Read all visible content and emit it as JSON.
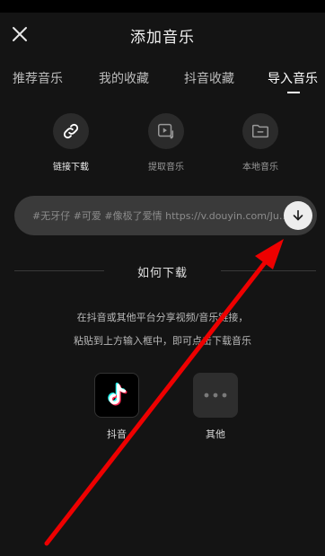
{
  "header": {
    "title": "添加音乐",
    "close_icon": "close-icon"
  },
  "tabs": [
    {
      "label": "推荐音乐",
      "active": false
    },
    {
      "label": "我的收藏",
      "active": false
    },
    {
      "label": "抖音收藏",
      "active": false
    },
    {
      "label": "导入音乐",
      "active": true
    }
  ],
  "import_options": [
    {
      "label": "链接下载",
      "icon": "link-icon",
      "active": true
    },
    {
      "label": "提取音乐",
      "icon": "video-music-icon",
      "active": false
    },
    {
      "label": "本地音乐",
      "icon": "folder-icon",
      "active": false
    }
  ],
  "link_input": {
    "value": "#无牙仔 #可爱 #像极了爱情 https://v.douyin.com/JuVfEhw/",
    "download_icon": "download-arrow-icon"
  },
  "how_to": {
    "title": "如何下载",
    "line1": "在抖音或其他平台分享视频/音乐链接，",
    "line2": "粘贴到上方输入框中，即可点击下载音乐"
  },
  "platforms": [
    {
      "label": "抖音",
      "icon": "tiktok-logo-icon"
    },
    {
      "label": "其他",
      "icon": "more-dots-icon"
    }
  ],
  "colors": {
    "background": "#141414",
    "input_bg": "#3a3a3a",
    "arrow": "#ee0000",
    "tiktok_cyan": "#25f4ee",
    "tiktok_red": "#fe2c55"
  }
}
